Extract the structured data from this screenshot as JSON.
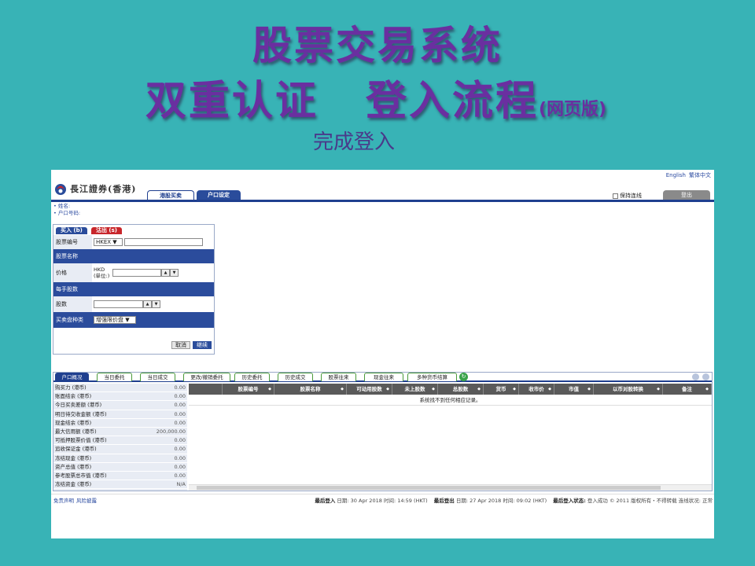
{
  "slide": {
    "title_line1": "股票交易系统",
    "title_line2_a": "双重认证",
    "title_line2_b": "登入流程",
    "title_line2_suffix": "(网页版)",
    "subtitle": "完成登入"
  },
  "app": {
    "lang_en": "English",
    "lang_tc": "繁体中文",
    "logo_text": "長江證券(香港)",
    "nav_tabs": [
      "港股买卖",
      "户口设定"
    ],
    "keep_login": "保持连线",
    "logout": "登出",
    "account_name_label": "• 姓名:",
    "account_no_label": "• 户口号码:",
    "order_form": {
      "buy_tab": "买入 (b)",
      "sell_tab": "沽出 (s)",
      "stock_code_label": "股票编号",
      "exchange_value": "HKEX",
      "stock_name_label": "股票名称",
      "price_label": "价格",
      "price_currency": "HKD",
      "price_unit": "(单位:)",
      "lot_size_label": "每手股数",
      "quantity_label": "股数",
      "order_type_label": "买卖盘种类",
      "order_type_value": "增强限价盘",
      "cancel_button": "取消",
      "continue_button": "继续"
    },
    "bottom_tabs": [
      "户口概况",
      "当日委托",
      "当日成交",
      "更改/撤销委托",
      "历史委托",
      "历史成交",
      "股票往来",
      "现金往来",
      "多种货币结算"
    ],
    "summary": [
      {
        "label": "购买力 (港币)",
        "value": "0.00"
      },
      {
        "label": "账面结余 (港币)",
        "value": "0.00"
      },
      {
        "label": "今日买卖差额 (港币)",
        "value": "0.00"
      },
      {
        "label": "明日待交收金额 (港币)",
        "value": "0.00"
      },
      {
        "label": "现金结余 (港币)",
        "value": "0.00"
      },
      {
        "label": "最大信用额 (港币)",
        "value": "200,000.00"
      },
      {
        "label": "可抵押股票价值 (港币)",
        "value": "0.00"
      },
      {
        "label": "追收保证金 (港币)",
        "value": "0.00"
      },
      {
        "label": "冻结现金 (港币)",
        "value": "0.00"
      },
      {
        "label": "资产总值 (港币)",
        "value": "0.00"
      },
      {
        "label": "参考股票总市值 (港币)",
        "value": "0.00"
      },
      {
        "label": "冻结资金 (港币)",
        "value": "N/A"
      }
    ],
    "grid_columns": [
      "股票编号",
      "股票名称",
      "可动用股数",
      "未上股数",
      "总股数",
      "货币",
      "收市价",
      "市值",
      "以币对股转换",
      "备注"
    ],
    "grid_empty": "系统找不到任何相应记录。",
    "footer": {
      "disclaimer": "免责声明",
      "risk": "风险披露",
      "last_login_label": "最后登入",
      "last_login_date": "日期: 30 Apr 2018",
      "last_login_time": "时间: 14:59 (HKT)",
      "last_logout_label": "最后登出",
      "last_logout_date": "日期: 27 Apr 2018",
      "last_logout_time": "时间: 09:02 (HKT)",
      "login_status_label": "最后登入状态:",
      "login_status_value": "登入成功",
      "copyright": "© 2011 版权所有・不得转载",
      "connection": "连线状况: 正常"
    }
  }
}
